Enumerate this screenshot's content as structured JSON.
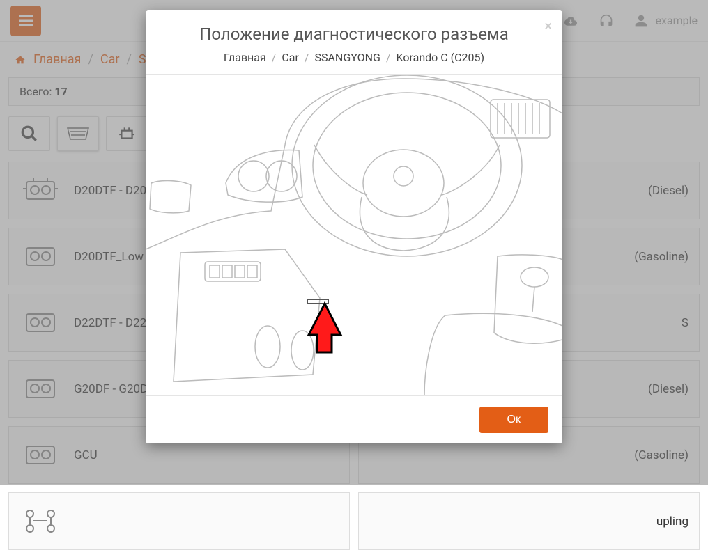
{
  "header": {
    "username": "example"
  },
  "breadcrumb": {
    "home": "Главная",
    "items": [
      "Car",
      "SS"
    ]
  },
  "total": {
    "label": "Всего: ",
    "count": "17"
  },
  "cards": [
    {
      "label": "D20DTF - D20"
    },
    {
      "label": "(Diesel)"
    },
    {
      "label": "D20DTF_Low -"
    },
    {
      "label": "(Gasoline)"
    },
    {
      "label": "D22DTF - D22"
    },
    {
      "label": "S"
    },
    {
      "label": "G20DF - G20D"
    },
    {
      "label": "(Diesel)"
    },
    {
      "label": "GCU"
    },
    {
      "label": "(Gasoline)"
    },
    {
      "label": ""
    },
    {
      "label": "upling"
    }
  ],
  "modal": {
    "title": "Положение диагностического разъема",
    "breadcrumb": [
      "Главная",
      "Car",
      "SSANGYONG",
      "Korando C (C205)"
    ],
    "ok": "Ок"
  }
}
